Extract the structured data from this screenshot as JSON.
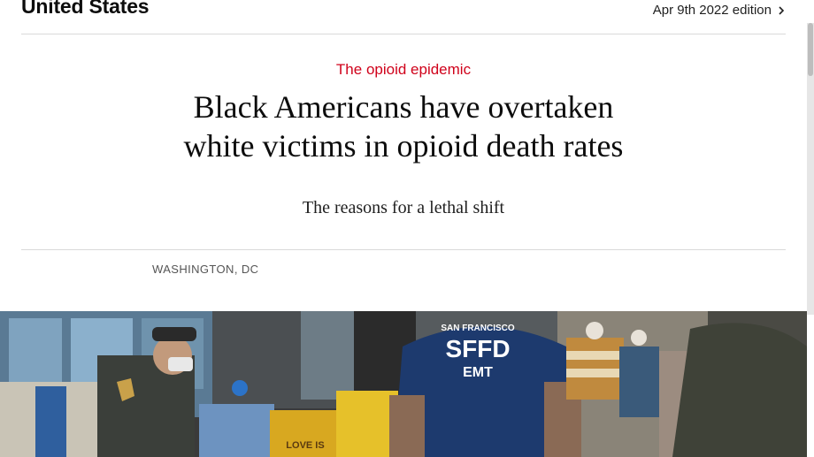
{
  "header": {
    "section_title": "United States",
    "edition_label": "Apr 9th 2022 edition",
    "edition_icon": "chevron-right-icon"
  },
  "article": {
    "flytitle": "The opioid epidemic",
    "headline_line1": "Black Americans have overtaken",
    "headline_line2": "white victims in opioid death rates",
    "rubric": "The reasons for a lethal shift",
    "dateline": "WASHINGTON, DC"
  },
  "hero_image": {
    "shirt_text_line1": "SAN FRANCISCO",
    "shirt_text_line2": "SFFD",
    "shirt_text_line3": "EMT",
    "store_sign_text": "LOVE IS"
  },
  "colors": {
    "flytitle_red": "#d0021b",
    "text_primary": "#0d0d0d",
    "divider": "#d9d9d9",
    "emt_shirt_navy": "#1d3a6e",
    "police_uniform": "#3b3f3a"
  }
}
